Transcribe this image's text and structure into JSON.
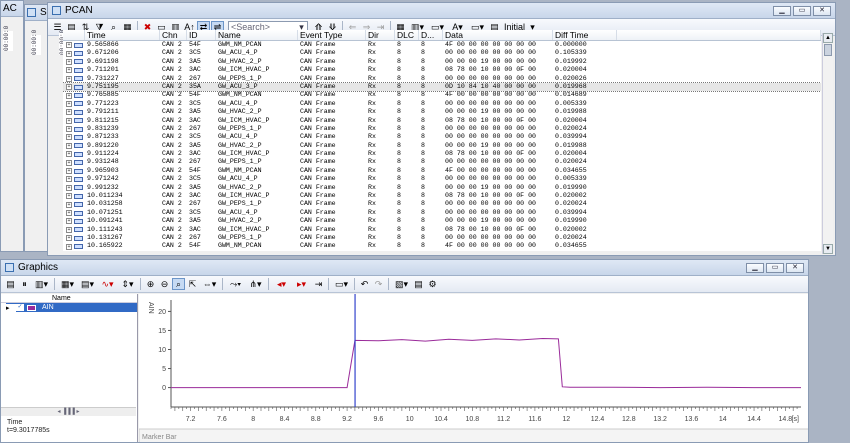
{
  "behind_windows": [
    {
      "title": "AC"
    },
    {
      "title": "SE"
    }
  ],
  "behind_labels": {
    "a": "00:00:0",
    "b": "00:00:0",
    "c": "00:00:0"
  },
  "pcan": {
    "title": "PCAN",
    "search_placeholder": "<Search>",
    "view_mode": "Initial",
    "columns": [
      "Time",
      "Chn",
      "ID",
      "Name",
      "Event Type",
      "Dir",
      "DLC",
      "D...",
      "Data",
      "Diff Time"
    ],
    "rows": [
      [
        "9.565866",
        "CAN 2",
        "54F",
        "GWM_NM_PCAN",
        "CAN Frame",
        "Rx",
        "8",
        "8",
        "4F 00 00 00 00 00 00 00",
        "0.000000"
      ],
      [
        "9.671206",
        "CAN 2",
        "3C5",
        "GW_ACU_4_P",
        "CAN Frame",
        "Rx",
        "8",
        "8",
        "00 00 00 00 00 00 00 00",
        "0.105339"
      ],
      [
        "9.691198",
        "CAN 2",
        "3A5",
        "GW_HVAC_2_P",
        "CAN Frame",
        "Rx",
        "8",
        "8",
        "00 00 00 19 00 00 00 00",
        "0.019992"
      ],
      [
        "9.711201",
        "CAN 2",
        "3AC",
        "GW_ICM_HVAC_P",
        "CAN Frame",
        "Rx",
        "8",
        "8",
        "08 78 00 10 00 00 0F 00",
        "0.020004"
      ],
      [
        "9.731227",
        "CAN 2",
        "267",
        "GW_PEPS_1_P",
        "CAN Frame",
        "Rx",
        "8",
        "8",
        "00 00 00 00 00 00 00 00",
        "0.020026"
      ],
      [
        "9.751195",
        "CAN 2",
        "35A",
        "GW_ACU_3_P",
        "CAN Frame",
        "Rx",
        "8",
        "8",
        "0D 10 84 10 40 00 00 00",
        "0.019968"
      ],
      [
        "9.765885",
        "CAN 2",
        "54F",
        "GWM_NM_PCAN",
        "CAN Frame",
        "Rx",
        "8",
        "8",
        "4F 00 00 00 00 00 00 00",
        "0.014689"
      ],
      [
        "9.771223",
        "CAN 2",
        "3C5",
        "GW_ACU_4_P",
        "CAN Frame",
        "Rx",
        "8",
        "8",
        "00 00 00 00 00 00 00 00",
        "0.005339"
      ],
      [
        "9.791211",
        "CAN 2",
        "3A5",
        "GW_HVAC_2_P",
        "CAN Frame",
        "Rx",
        "8",
        "8",
        "00 00 00 19 00 00 00 00",
        "0.019988"
      ],
      [
        "9.811215",
        "CAN 2",
        "3AC",
        "GW_ICM_HVAC_P",
        "CAN Frame",
        "Rx",
        "8",
        "8",
        "08 78 00 10 00 00 0F 00",
        "0.020004"
      ],
      [
        "9.831239",
        "CAN 2",
        "267",
        "GW_PEPS_1_P",
        "CAN Frame",
        "Rx",
        "8",
        "8",
        "00 00 00 00 00 00 00 00",
        "0.020024"
      ],
      [
        "9.871233",
        "CAN 2",
        "3C5",
        "GW_ACU_4_P",
        "CAN Frame",
        "Rx",
        "8",
        "8",
        "00 00 00 00 00 00 00 00",
        "0.039994"
      ],
      [
        "9.891220",
        "CAN 2",
        "3A5",
        "GW_HVAC_2_P",
        "CAN Frame",
        "Rx",
        "8",
        "8",
        "00 00 00 19 00 00 00 00",
        "0.019988"
      ],
      [
        "9.911224",
        "CAN 2",
        "3AC",
        "GW_ICM_HVAC_P",
        "CAN Frame",
        "Rx",
        "8",
        "8",
        "08 78 00 10 00 00 0F 00",
        "0.020004"
      ],
      [
        "9.931248",
        "CAN 2",
        "267",
        "GW_PEPS_1_P",
        "CAN Frame",
        "Rx",
        "8",
        "8",
        "00 00 00 00 00 00 00 00",
        "0.020024"
      ],
      [
        "9.965903",
        "CAN 2",
        "54F",
        "GWM_NM_PCAN",
        "CAN Frame",
        "Rx",
        "8",
        "8",
        "4F 00 00 00 00 00 00 00",
        "0.034655"
      ],
      [
        "9.971242",
        "CAN 2",
        "3C5",
        "GW_ACU_4_P",
        "CAN Frame",
        "Rx",
        "8",
        "8",
        "00 00 00 00 00 00 00 00",
        "0.005339"
      ],
      [
        "9.991232",
        "CAN 2",
        "3A5",
        "GW_HVAC_2_P",
        "CAN Frame",
        "Rx",
        "8",
        "8",
        "00 00 00 19 00 00 00 00",
        "0.019990"
      ],
      [
        "10.011234",
        "CAN 2",
        "3AC",
        "GW_ICM_HVAC_P",
        "CAN Frame",
        "Rx",
        "8",
        "8",
        "08 78 00 10 00 00 0F 00",
        "0.020002"
      ],
      [
        "10.031258",
        "CAN 2",
        "267",
        "GW_PEPS_1_P",
        "CAN Frame",
        "Rx",
        "8",
        "8",
        "00 00 00 00 00 00 00 00",
        "0.020024"
      ],
      [
        "10.071251",
        "CAN 2",
        "3C5",
        "GW_ACU_4_P",
        "CAN Frame",
        "Rx",
        "8",
        "8",
        "00 00 00 00 00 00 00 00",
        "0.039994"
      ],
      [
        "10.091241",
        "CAN 2",
        "3A5",
        "GW_HVAC_2_P",
        "CAN Frame",
        "Rx",
        "8",
        "8",
        "00 00 00 19 00 00 00 00",
        "0.019990"
      ],
      [
        "10.111243",
        "CAN 2",
        "3AC",
        "GW_ICM_HVAC_P",
        "CAN Frame",
        "Rx",
        "8",
        "8",
        "08 78 00 10 00 00 0F 00",
        "0.020002"
      ],
      [
        "10.131267",
        "CAN 2",
        "267",
        "GW_PEPS_1_P",
        "CAN Frame",
        "Rx",
        "8",
        "8",
        "00 00 00 00 00 00 00 00",
        "0.020024"
      ],
      [
        "10.165922",
        "CAN 2",
        "54F",
        "GWM_NM_PCAN",
        "CAN Frame",
        "Rx",
        "8",
        "8",
        "4F 00 00 00 00 00 00 00",
        "0.034655"
      ]
    ],
    "selected_row": 5
  },
  "graphics": {
    "title": "Graphics",
    "signal_list_header": "Name",
    "signal_name": "AIN",
    "time_label": "Time",
    "time_value": "t=9.3017785s",
    "marker_bar": "Marker Bar",
    "colors": {
      "signal": "#9a2b9a",
      "cursor": "#3344cc",
      "axis_text": "#444444"
    }
  },
  "chart_data": {
    "type": "line",
    "ylabel": "AIN",
    "xunit": "[s]",
    "xlim": [
      6.95,
      15.0
    ],
    "ylim": [
      -3,
      23
    ],
    "xticks": [
      7.2,
      7.6,
      8,
      8.4,
      8.8,
      9.2,
      9.6,
      10,
      10.4,
      10.8,
      11.2,
      11.6,
      12,
      12.4,
      12.8,
      13.2,
      13.6,
      14,
      14.4,
      14.8
    ],
    "xtick_labels": [
      "7.2",
      "7.6",
      "8",
      "8.4",
      "8.8",
      "9.2",
      "9.6",
      "10",
      "10.4",
      "10.8",
      "11.2",
      "11.6",
      "12",
      "12.4",
      "12.8",
      "13.2",
      "13.6",
      "14",
      "14.4",
      "14.8"
    ],
    "yticks": [
      0,
      5,
      10,
      15,
      20
    ],
    "ytick_labels": [
      "0",
      "5",
      "10",
      "15",
      "20"
    ],
    "cursor_x": 9.3017785,
    "series": [
      {
        "x": [
          6.95,
          9.2,
          9.3,
          9.6,
          9.9,
          10.2,
          10.5,
          10.8,
          11.1,
          11.4,
          11.7,
          11.9,
          11.95,
          12.05,
          12.6,
          13.2,
          13.8,
          14.4,
          15.0
        ],
        "y": [
          0,
          0,
          12.4,
          12.3,
          12.6,
          12.2,
          12.7,
          12.4,
          12.8,
          12.5,
          12.9,
          12.8,
          0.2,
          0.1,
          0.1,
          0,
          0.1,
          0,
          0
        ]
      }
    ]
  }
}
